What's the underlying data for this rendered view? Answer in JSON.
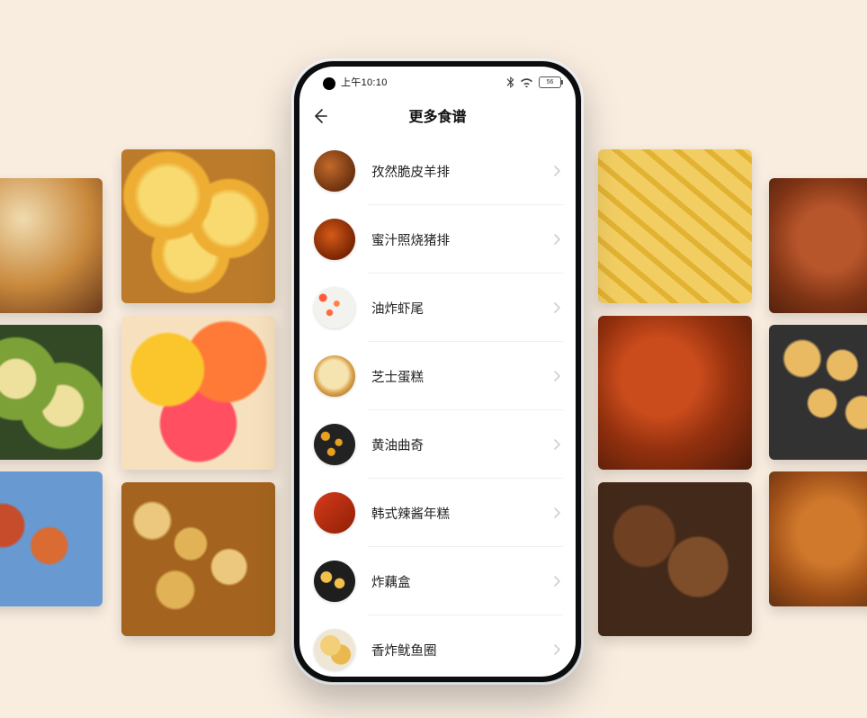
{
  "status": {
    "time": "上午10:10",
    "battery_text": "56"
  },
  "appbar": {
    "title": "更多食谱"
  },
  "recipes": [
    {
      "label": "孜然脆皮羊排"
    },
    {
      "label": "蜜汁照烧猪排"
    },
    {
      "label": "油炸虾尾"
    },
    {
      "label": "芝士蛋糕"
    },
    {
      "label": "黄油曲奇"
    },
    {
      "label": "韩式辣酱年糕"
    },
    {
      "label": "炸藕盒"
    },
    {
      "label": "香炸鱿鱼圈"
    }
  ]
}
